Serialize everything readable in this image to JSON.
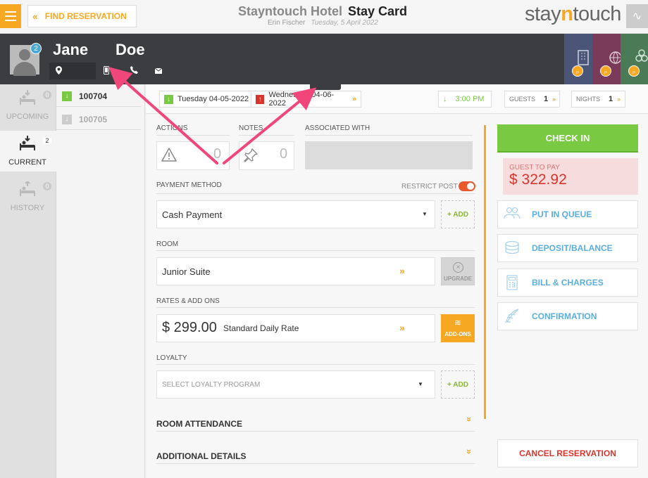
{
  "header": {
    "find_reservation": "FIND RESERVATION",
    "hotel": "Stayntouch Hotel",
    "page": "Stay Card",
    "user": "Erin Fischer",
    "date": "Tuesday, 5 April 2022",
    "logo_a": "stay",
    "logo_n": "n",
    "logo_b": "touch"
  },
  "guest": {
    "first_name": "Jane",
    "last_name": "Doe",
    "badge": "2"
  },
  "sidebar": {
    "items": [
      {
        "label": "UPCOMING",
        "count": "0"
      },
      {
        "label": "CURRENT",
        "count": "2"
      },
      {
        "label": "HISTORY",
        "count": "0"
      }
    ]
  },
  "reservations": [
    {
      "number": "100704"
    },
    {
      "number": "100705"
    }
  ],
  "dates": {
    "arrival": "Tuesday 04-05-2022",
    "departure": "Wednesday 04-06-2022",
    "time": "3:00 PM",
    "guests_label": "GUESTS",
    "guests": "1",
    "nights_label": "NIGHTS",
    "nights": "1"
  },
  "sections": {
    "actions_label": "ACTIONS",
    "actions_count": "0",
    "notes_label": "NOTES",
    "notes_count": "0",
    "associated_label": "ASSOCIATED WITH",
    "payment_label": "PAYMENT METHOD",
    "restrict_post": "RESTRICT POST",
    "payment_value": "Cash Payment",
    "add": "+ ADD",
    "room_label": "ROOM",
    "room_value": "Junior Suite",
    "upgrade": "UPGRADE",
    "rates_label": "RATES & ADD ONS",
    "rate_amount": "$ 299.00",
    "rate_name": "Standard Daily Rate",
    "addons": "ADD-ONS",
    "loyalty_label": "LOYALTY",
    "loyalty_placeholder": "SELECT LOYALTY PROGRAM",
    "room_attendance": "ROOM ATTENDANCE",
    "additional_details": "ADDITIONAL DETAILS"
  },
  "right": {
    "check_in": "CHECK IN",
    "guest_to_pay_label": "GUEST TO PAY",
    "guest_to_pay": "$ 322.92",
    "put_in_queue": "PUT IN QUEUE",
    "deposit": "DEPOSIT/BALANCE",
    "bill": "BILL & CHARGES",
    "confirmation": "CONFIRMATION",
    "cancel": "CANCEL RESERVATION"
  },
  "colors": {
    "accent": "#f7a823",
    "check_in": "#7ac943",
    "cancel_text": "#d9342b",
    "link_blue": "#5aaede",
    "annotation_arrow": "#f0467a"
  }
}
